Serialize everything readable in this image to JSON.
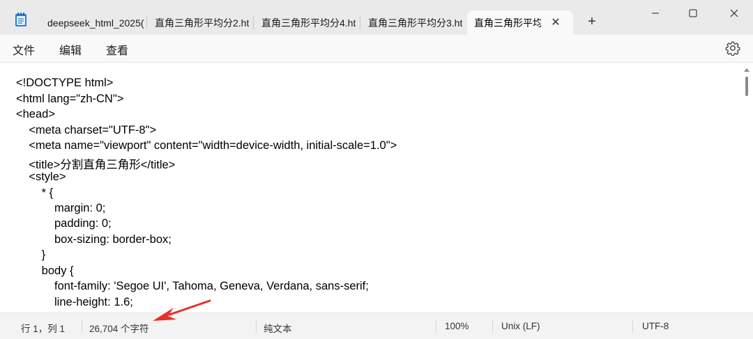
{
  "tabs": [
    {
      "label": "deepseek_html_2025(",
      "active": false
    },
    {
      "label": "直角三角形平均分2.ht",
      "active": false
    },
    {
      "label": "直角三角形平均分4.ht",
      "active": false
    },
    {
      "label": "直角三角形平均分3.ht",
      "active": false
    },
    {
      "label": "直角三角形平均",
      "active": true
    }
  ],
  "tab_close_glyph": "✕",
  "new_tab_glyph": "+",
  "window_controls": {
    "minimize": "minimize-icon",
    "maximize": "maximize-icon",
    "close": "close-icon"
  },
  "menu": {
    "file": "文件",
    "edit": "编辑",
    "view": "查看"
  },
  "code_lines": [
    "<!DOCTYPE html>",
    "<html lang=\"zh-CN\">",
    "<head>",
    "    <meta charset=\"UTF-8\">",
    "    <meta name=\"viewport\" content=\"width=device-width, initial-scale=1.0\">",
    "    <title>分割直角三角形</title>",
    "    <style>",
    "        * {",
    "            margin: 0;",
    "            padding: 0;",
    "            box-sizing: border-box;",
    "        }",
    "        body {",
    "            font-family: 'Segoe UI', Tahoma, Geneva, Verdana, sans-serif;",
    "            line-height: 1.6;"
  ],
  "status": {
    "position": "行 1，列 1",
    "char_count": "26,704 个字符",
    "format": "纯文本",
    "zoom": "100%",
    "line_ending": "Unix (LF)",
    "encoding": "UTF-8"
  },
  "colors": {
    "annotation": "#e8302a",
    "app_icon": "#2b7bd6"
  }
}
